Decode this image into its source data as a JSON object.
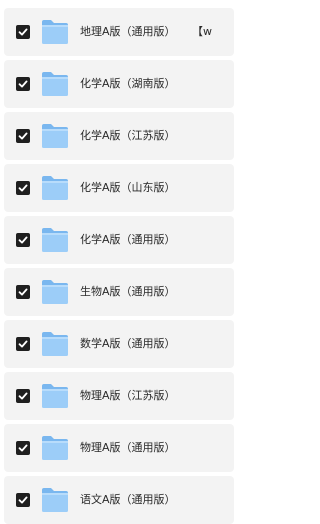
{
  "colors": {
    "row_background": "#f3f3f3",
    "checkbox": "#1f1f1f",
    "folder": "#8cc3f5",
    "text": "#2a2a2a"
  },
  "file_list": {
    "items": [
      {
        "name": "地理A版（通用版）",
        "checked": true,
        "icon": "folder-icon",
        "suffix": "【w"
      },
      {
        "name": "化学A版（湖南版）",
        "checked": true,
        "icon": "folder-icon"
      },
      {
        "name": "化学A版（江苏版）",
        "checked": true,
        "icon": "folder-icon"
      },
      {
        "name": "化学A版（山东版）",
        "checked": true,
        "icon": "folder-icon"
      },
      {
        "name": "化学A版（通用版）",
        "checked": true,
        "icon": "folder-icon"
      },
      {
        "name": "生物A版（通用版）",
        "checked": true,
        "icon": "folder-icon"
      },
      {
        "name": "数学A版（通用版）",
        "checked": true,
        "icon": "folder-icon"
      },
      {
        "name": "物理A版（江苏版）",
        "checked": true,
        "icon": "folder-icon"
      },
      {
        "name": "物理A版（通用版）",
        "checked": true,
        "icon": "folder-icon"
      },
      {
        "name": "语文A版（通用版）",
        "checked": true,
        "icon": "folder-icon"
      }
    ]
  }
}
